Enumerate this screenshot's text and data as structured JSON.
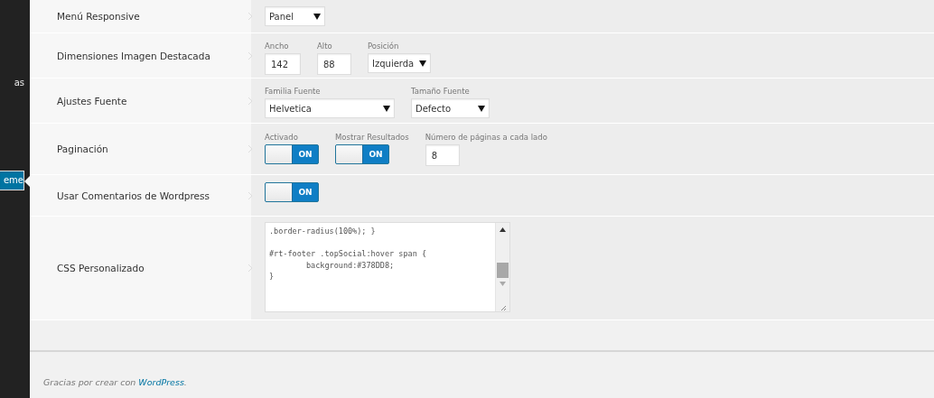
{
  "sidebar": {
    "items": [
      {
        "label": "as",
        "selected": false
      },
      {
        "label": "eme",
        "selected": true
      }
    ]
  },
  "settings": [
    {
      "label": "Menú Responsive",
      "controls": [
        {
          "kind": "select",
          "value": "Panel"
        }
      ]
    },
    {
      "label": "Dimensiones Imagen Destacada",
      "controls": [
        {
          "kind": "input",
          "caption": "Ancho",
          "value": "142"
        },
        {
          "kind": "input",
          "caption": "Alto",
          "value": "88"
        },
        {
          "kind": "select",
          "caption": "Posición",
          "value": "Izquierda"
        }
      ]
    },
    {
      "label": "Ajustes Fuente",
      "controls": [
        {
          "kind": "select",
          "caption": "Familia Fuente",
          "value": "Helvetica"
        },
        {
          "kind": "select",
          "caption": "Tamaño Fuente",
          "value": "Defecto"
        }
      ]
    },
    {
      "label": "Paginación",
      "controls": [
        {
          "kind": "toggle",
          "caption": "Activado",
          "on": true,
          "text": "ON"
        },
        {
          "kind": "toggle",
          "caption": "Mostrar Resultados",
          "on": true,
          "text": "ON"
        },
        {
          "kind": "input",
          "caption": "Número de páginas a cada lado",
          "value": "8"
        }
      ]
    },
    {
      "label": "Usar Comentarios de Wordpress",
      "controls": [
        {
          "kind": "toggle",
          "on": true,
          "text": "ON"
        }
      ]
    },
    {
      "label": "CSS Personalizado",
      "controls": [
        {
          "kind": "textarea",
          "value": ".border-radius(100%); }\n\n#rt-footer .topSocial:hover span {\n\tbackground:#378DD8;\n}"
        }
      ]
    }
  ],
  "footer": {
    "text": "Gracias por crear con ",
    "link": "WordPress",
    "end": "."
  }
}
